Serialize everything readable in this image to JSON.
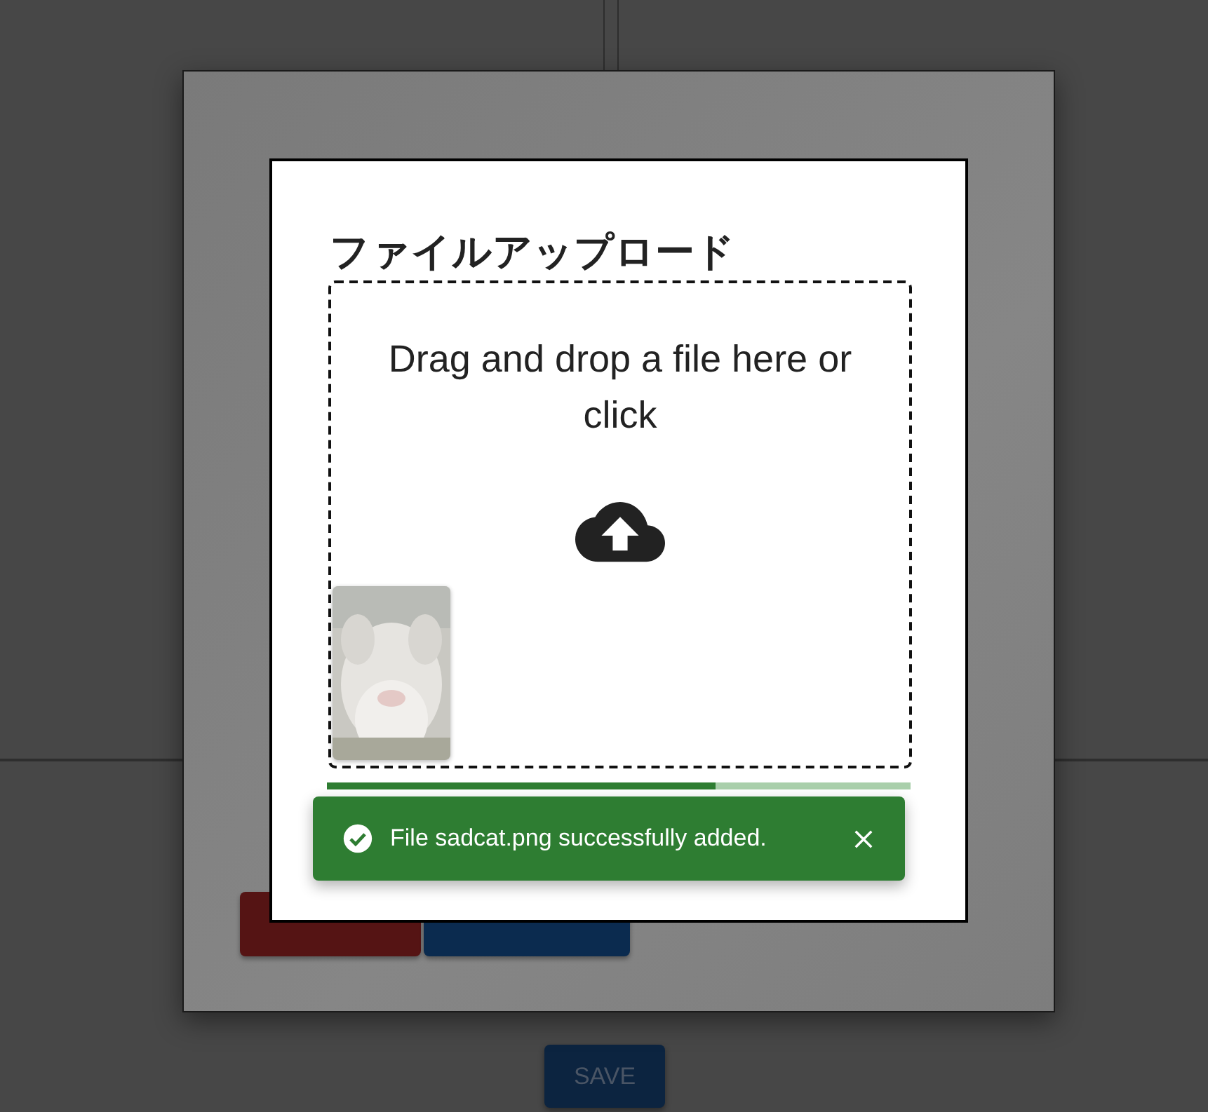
{
  "page": {
    "save_button": "SAVE"
  },
  "background_dialog": {
    "buttons": [
      {
        "kind": "danger"
      },
      {
        "kind": "primary"
      }
    ]
  },
  "upload_dialog": {
    "title": "ファイルアップロード",
    "dropzone_text": "Drag and drop a file here or click",
    "progress": {
      "level": 0.665
    }
  },
  "snackbar": {
    "message": "File sadcat.png successfully added."
  }
}
